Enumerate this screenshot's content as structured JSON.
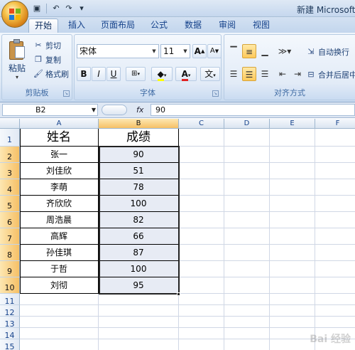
{
  "window": {
    "title": "新建 Microsoft O"
  },
  "quick_access": {
    "icons": [
      "save-icon",
      "undo-icon",
      "redo-icon",
      "customize-icon"
    ]
  },
  "tabs": [
    "开始",
    "插入",
    "页面布局",
    "公式",
    "数据",
    "审阅",
    "视图"
  ],
  "active_tab": "开始",
  "clipboard": {
    "paste_label": "粘贴",
    "cut_label": "剪切",
    "copy_label": "复制",
    "format_painter_label": "格式刷",
    "group_label": "剪贴板"
  },
  "font": {
    "name": "宋体",
    "size": "11",
    "grow_label": "A",
    "shrink_label": "A",
    "bold": "B",
    "italic": "I",
    "underline": "U",
    "font_color_label": "A",
    "phonetic_label": "文",
    "group_label": "字体"
  },
  "alignment": {
    "wrap_text_label": "自动换行",
    "merge_label": "合并后居中",
    "group_label": "对齐方式"
  },
  "formula_bar": {
    "name_box": "B2",
    "fx_label": "fx",
    "formula": "90"
  },
  "columns": [
    "A",
    "B",
    "C",
    "D",
    "E",
    "F"
  ],
  "rows": [
    "1",
    "2",
    "3",
    "4",
    "5",
    "6",
    "7",
    "8",
    "9",
    "10",
    "11",
    "12",
    "13",
    "14",
    "15"
  ],
  "sheet": {
    "headers": [
      "姓名",
      "成绩"
    ],
    "records": [
      {
        "name": "张一",
        "score": "90"
      },
      {
        "name": "刘佳欣",
        "score": "51"
      },
      {
        "name": "李萌",
        "score": "78"
      },
      {
        "name": "齐欣欣",
        "score": "100"
      },
      {
        "name": "周浩晨",
        "score": "82"
      },
      {
        "name": "高辉",
        "score": "66"
      },
      {
        "name": "孙佳琪",
        "score": "87"
      },
      {
        "name": "于哲",
        "score": "100"
      },
      {
        "name": "刘彻",
        "score": "95"
      }
    ]
  },
  "colors": {
    "accent": "#f6c066",
    "selection_fill": "#e7ebf4"
  },
  "watermark": "Bai 经验"
}
